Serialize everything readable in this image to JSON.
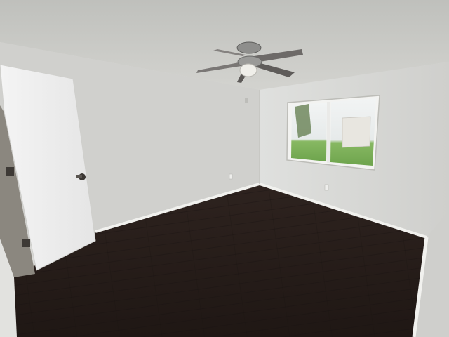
{
  "scene": {
    "subject": "empty-bedroom",
    "colors": {
      "ceiling": "#cfcfcb",
      "left_wall": "#d3d3d0",
      "back_wall": "#d7d8d6",
      "right_wall": "#dadbd9",
      "floor_dark": "#221a17",
      "floor_mid": "#2f2420",
      "baseboard": "#f1f1ee",
      "door": "#eeeeee",
      "door_frame": "#e6e6e3",
      "fan_metal": "#8a8a88",
      "fan_blade": "#6d6a68",
      "window_grass": "#7fb25b",
      "window_sky": "#eef2f2"
    }
  }
}
